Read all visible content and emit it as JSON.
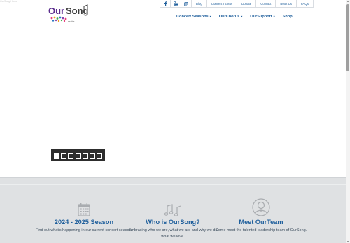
{
  "corner_text": "OurSong Home",
  "logo": {
    "wordmark": "OurSong",
    "tagline": "seattle",
    "colors": {
      "our": "#5b2d8e",
      "song": "#3d3d3d",
      "notes": [
        "#e63b7a",
        "#f29c1f",
        "#3fae49",
        "#2a7bc1",
        "#8e44ad"
      ]
    }
  },
  "topbar": {
    "social": [
      "facebook-icon",
      "youtube-icon",
      "instagram-icon"
    ],
    "links": [
      "Blog",
      "Concert Tickets",
      "Donate",
      "Contact",
      "Book Us",
      "FAQs"
    ]
  },
  "nav": {
    "items": [
      {
        "label": "Concert Seasons",
        "caret": "▾"
      },
      {
        "label": "OurChorus",
        "caret": "▾"
      },
      {
        "label": "OurSupport",
        "caret": "▾"
      },
      {
        "label": "Shop",
        "caret": ""
      }
    ]
  },
  "slider": {
    "slides": 7,
    "active_slide": 1
  },
  "features": [
    {
      "icon": "calendar-icon",
      "title": "2024 - 2025 Season",
      "text": "Find out what's happening in our current concert season!"
    },
    {
      "icon": "music-notes-icon",
      "title": "Who is OurSong?",
      "text": "Embracing who we are, what we are and why we do what we love."
    },
    {
      "icon": "person-avatar-icon",
      "title": "Meet OurTeam",
      "text": "Come meet the talented leadership team of OurSong."
    }
  ],
  "colors": {
    "accent": "#1f5f9c",
    "band": "#dfe1e3",
    "pager": "#2d2d2d",
    "icon": "#a9acb0"
  }
}
